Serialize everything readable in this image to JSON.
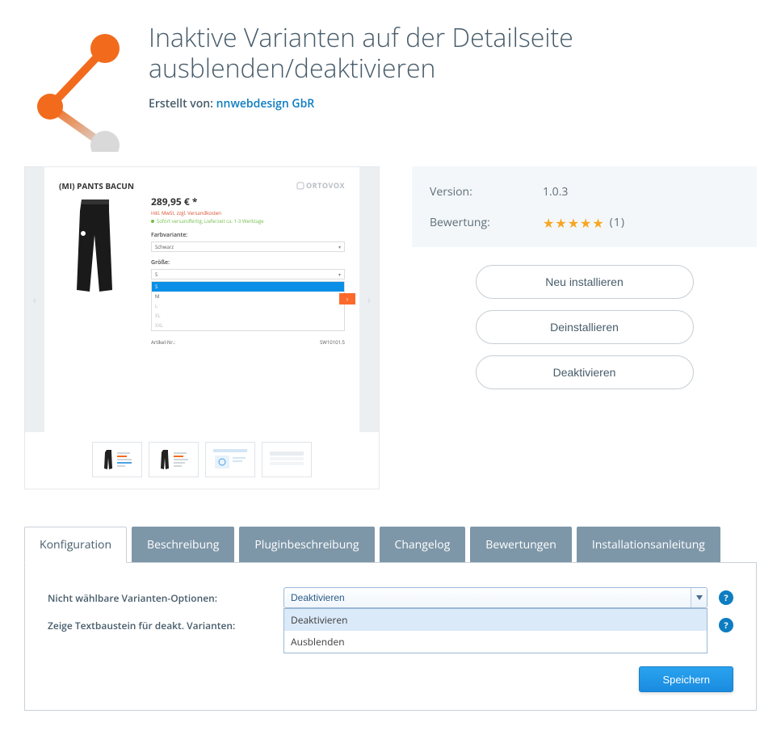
{
  "header": {
    "title": "Inaktive Varianten auf der Detailseite ausblenden/deaktivieren",
    "created_label": "Erstellt von:",
    "author": "nnwebdesign GbR"
  },
  "preview": {
    "product_name": "(MI) PANTS BACUN",
    "brand": "ORTOVOX",
    "price": "289,95 € *",
    "price_note": "inkl. MwSt. zzgl. Versandkosten",
    "shipping_note": "Sofort versandfertig, Lieferzeit ca. 1-3 Werktage",
    "color_label": "Farbvariante:",
    "color_value": "Schwarz",
    "size_label": "Größe:",
    "size_value": "S",
    "size_options": [
      "S",
      "M",
      "L",
      "XL",
      "XXL"
    ],
    "article_label": "Artikel-Nr.:",
    "article_value": "SW10101.5"
  },
  "info": {
    "version_label": "Version:",
    "version_value": "1.0.3",
    "rating_label": "Bewertung:",
    "rating_stars": 5,
    "rating_count": "(1)"
  },
  "actions": {
    "install": "Neu installieren",
    "uninstall": "Deinstallieren",
    "deactivate": "Deaktivieren"
  },
  "tabs": [
    "Konfiguration",
    "Beschreibung",
    "Pluginbeschreibung",
    "Changelog",
    "Bewertungen",
    "Installationsanleitung"
  ],
  "config": {
    "field1_label": "Nicht wählbare Varianten-Optionen:",
    "field1_value": "Deaktivieren",
    "field1_options": [
      "Deaktivieren",
      "Ausblenden"
    ],
    "field2_label": "Zeige Textbaustein für deakt. Varianten:",
    "save": "Speichern"
  }
}
